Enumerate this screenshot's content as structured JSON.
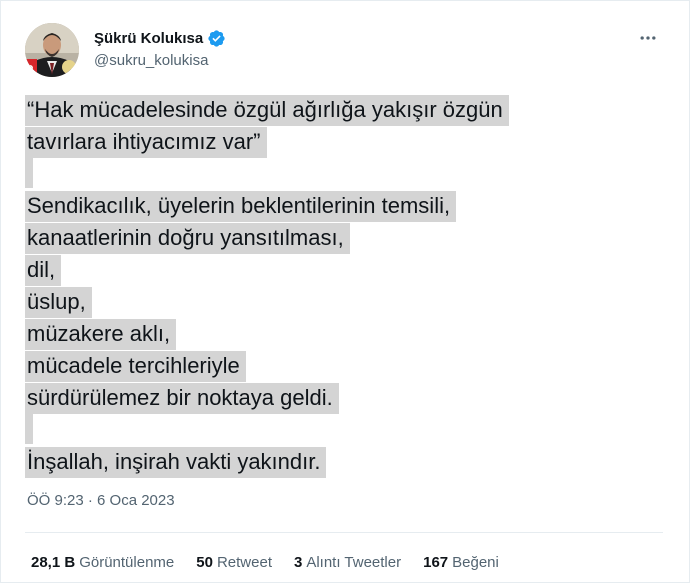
{
  "user": {
    "display_name": "Şükrü Kolukısa",
    "handle": "@sukru_kolukisa"
  },
  "tweet": {
    "lines": [
      "“Hak mücadelesinde özgül ağırlığa yakışır özgün",
      "tavırlara ihtiyacımız var”",
      "",
      "Sendikacılık, üyelerin beklentilerinin temsili,",
      "kanaatlerinin doğru yansıtılması,",
      "dil,",
      "üslup,",
      "müzakere aklı,",
      "mücadele tercihleriyle",
      "sürdürülemez bir noktaya geldi.",
      "",
      "İnşallah, inşirah vakti yakındır."
    ],
    "timestamp": "ÖÖ 9:23 · 6 Oca 2023"
  },
  "stats": {
    "views_count": "28,1 B",
    "views_label": "Görüntülenme",
    "retweets_count": "50",
    "retweets_label": "Retweet",
    "quotes_count": "3",
    "quotes_label": "Alıntı Tweetler",
    "likes_count": "167",
    "likes_label": "Beğeni"
  },
  "colors": {
    "verified_blue": "#1d9bf0",
    "highlight": "#d4d4d4",
    "secondary_text": "#536471"
  },
  "icons": {
    "verified": "verified-badge-icon",
    "more": "more-horizontal-icon"
  }
}
